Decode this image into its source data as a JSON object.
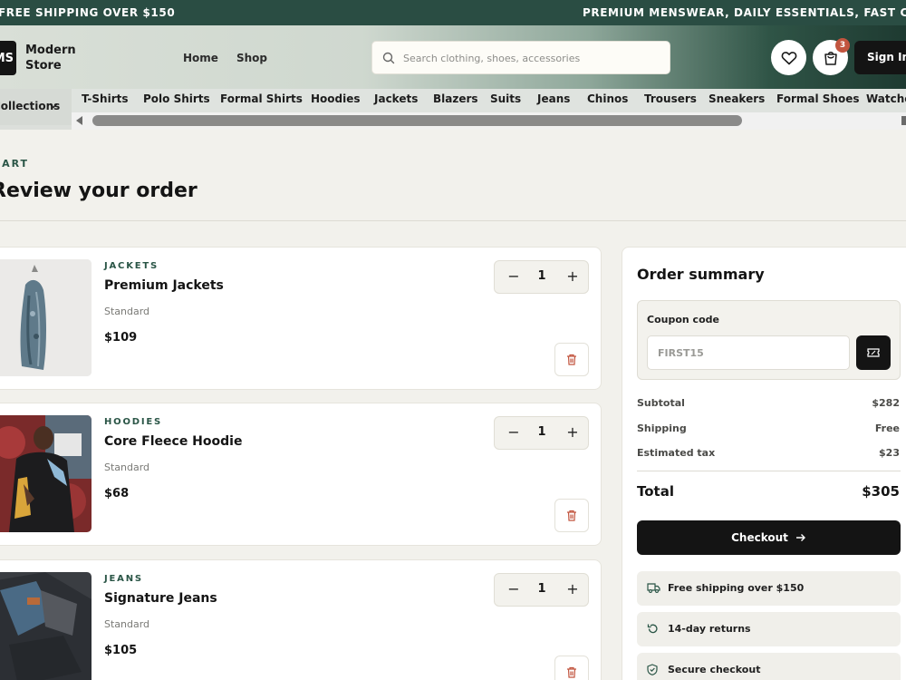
{
  "promo": {
    "left": "FREE SHIPPING OVER $150",
    "right": "PREMIUM MENSWEAR, DAILY ESSENTIALS, FAST CHECKOUT"
  },
  "header": {
    "logo_mark": "MS",
    "logo_line1": "Modern",
    "logo_line2": "Store",
    "nav": [
      "Home",
      "Shop"
    ],
    "search_placeholder": "Search clothing, shoes, accessories",
    "cart_count": "3",
    "signin": "Sign In"
  },
  "categories": {
    "collections_label": "Collections",
    "items": [
      "T-Shirts",
      "Polo Shirts",
      "Formal Shirts",
      "Hoodies",
      "Jackets",
      "Blazers",
      "Suits",
      "Jeans",
      "Chinos",
      "Trousers",
      "Sneakers",
      "Formal Shoes",
      "Watches"
    ]
  },
  "page": {
    "eyebrow": "CART",
    "title": "Review your order"
  },
  "items": [
    {
      "category": "JACKETS",
      "name": "Premium Jackets",
      "variant": "Standard",
      "price": "$109",
      "qty": "1"
    },
    {
      "category": "HOODIES",
      "name": "Core Fleece Hoodie",
      "variant": "Standard",
      "price": "$68",
      "qty": "1"
    },
    {
      "category": "JEANS",
      "name": "Signature Jeans",
      "variant": "Standard",
      "price": "$105",
      "qty": "1"
    }
  ],
  "summary": {
    "title": "Order summary",
    "coupon_label": "Coupon code",
    "coupon_placeholder": "FIRST15",
    "subtotal_label": "Subtotal",
    "subtotal": "$282",
    "shipping_label": "Shipping",
    "shipping": "Free",
    "tax_label": "Estimated tax",
    "tax": "$23",
    "total_label": "Total",
    "total": "$305",
    "checkout": "Checkout",
    "perks": [
      "Free shipping over $150",
      "14-day returns",
      "Secure checkout"
    ]
  },
  "colors": {
    "brand_green": "#2a4d43",
    "accent_text": "#2a5546",
    "badge": "#c2553f",
    "dark": "#141414"
  }
}
